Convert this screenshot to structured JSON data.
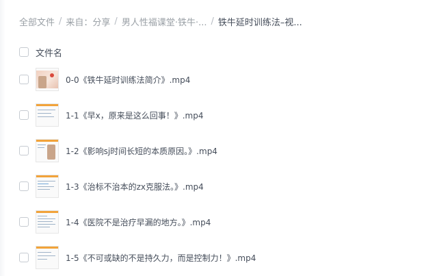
{
  "breadcrumb": {
    "all_files": "全部文件",
    "from": "来自：分享",
    "folder": "男人性福课堂·铁牛·...",
    "current": "铁牛延时训练法–视...",
    "separator": "/"
  },
  "list_header": {
    "name_label": "文件名"
  },
  "files": [
    {
      "name": "0-0《铁牛延时训练法简介》.mp4",
      "thumb_icon": "video-thumbnail-icon"
    },
    {
      "name": "1-1《早x，原来是这么回事！》.mp4",
      "thumb_icon": "video-thumbnail-icon"
    },
    {
      "name": "1-2《影响sj时间长短的本质原因。》.mp4",
      "thumb_icon": "video-thumbnail-icon"
    },
    {
      "name": "1-3《治标不治本的zx克服法。》.mp4",
      "thumb_icon": "video-thumbnail-icon"
    },
    {
      "name": "1-4《医院不是治疗早漏的地方。》.mp4",
      "thumb_icon": "video-thumbnail-icon"
    },
    {
      "name": "1-5《不可或缺的不是持久力，而是控制力！》.mp4",
      "thumb_icon": "video-thumbnail-icon"
    }
  ],
  "colors": {
    "text_primary": "#454d5a",
    "text_muted": "#9aa0a6",
    "thumb_accent": "#f2a33a"
  }
}
